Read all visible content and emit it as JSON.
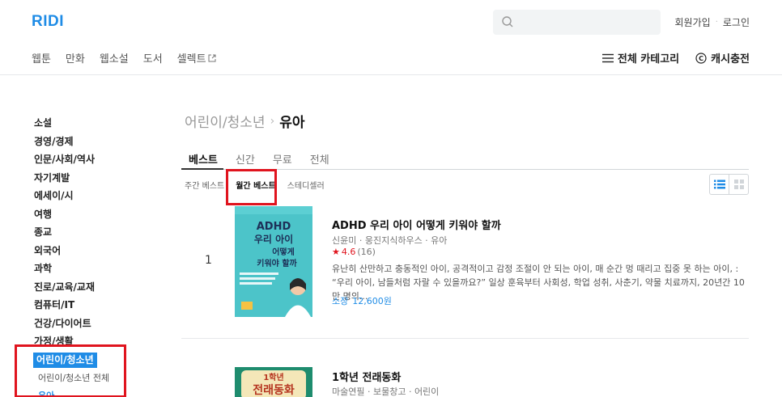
{
  "header": {
    "logo": "RIDI",
    "search_placeholder": "",
    "signup": "회원가입",
    "login": "로그인"
  },
  "nav": {
    "items": [
      "웹툰",
      "만화",
      "웹소설",
      "도서",
      "셀렉트"
    ],
    "all_categories": "전체 카테고리",
    "cash_charge": "캐시충전"
  },
  "sidebar": {
    "categories": [
      "소설",
      "경영/경제",
      "인문/사회/역사",
      "자기계발",
      "에세이/시",
      "여행",
      "종교",
      "외국어",
      "과학",
      "진로/교육/교재",
      "컴퓨터/IT",
      "건강/다이어트",
      "가정/생활"
    ],
    "active_category": "어린이/청소년",
    "sub_all": "어린이/청소년 전체",
    "sub_selected": "유아"
  },
  "breadcrumb": {
    "parent": "어린이/청소년",
    "current": "유아"
  },
  "tabs": [
    "베스트",
    "신간",
    "무료",
    "전체"
  ],
  "subtabs": [
    "주간 베스트",
    "월간 베스트",
    "스테디셀러"
  ],
  "books": [
    {
      "rank": "1",
      "title": "ADHD 우리 아이 어떻게 키워야 할까",
      "meta": "신윤미 · 웅진지식하우스 · 유아",
      "rating": "4.6",
      "rating_count": "(16)",
      "description": "유난히 산만하고 충동적인 아이, 공격적이고 감정 조절이 안 되는 아이, 매 순간 멍 때리고 집중 못 하는 아이, : “우리 아이, 남들처럼 자랄 수 있을까요?” 일상 훈육부터 사회성, 학업 성취, 사춘기, 약물 치료까지, 20년간 10만 명의...",
      "price_label": "소장",
      "price": "12,600원",
      "cover": {
        "line1": "ADHD",
        "line2": "우리 아이",
        "line3": "어떻게",
        "line4": "키워야 할까"
      }
    },
    {
      "title": "1학년 전래동화",
      "meta": "마술연필 · 보물창고 · 어린이",
      "cover": {
        "line1": "1학년",
        "line2": "전래동화"
      }
    }
  ],
  "colors": {
    "accent": "#1f8ce6",
    "highlight": "#e0141e"
  }
}
